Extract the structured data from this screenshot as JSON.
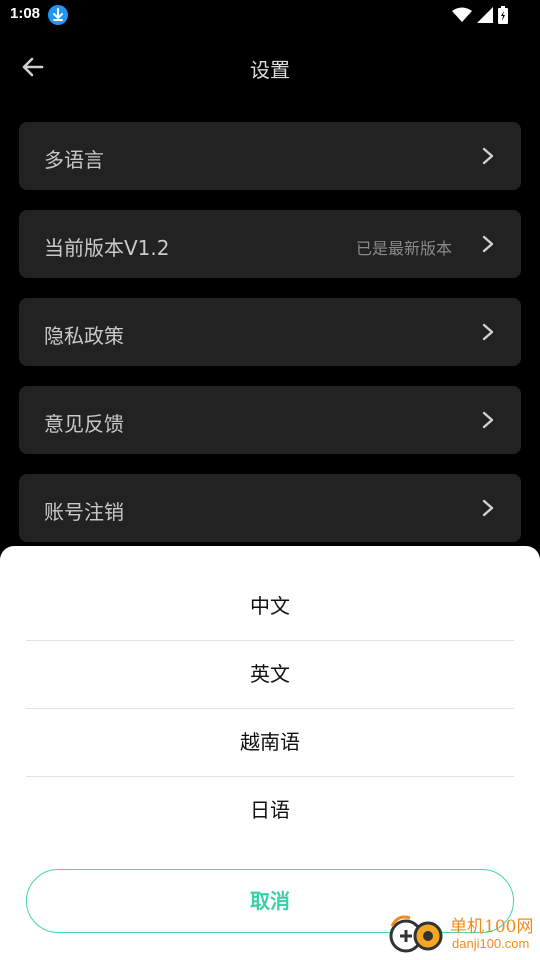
{
  "status_bar": {
    "time": "1:08"
  },
  "header": {
    "title": "设置"
  },
  "settings": [
    {
      "label": "多语言",
      "value": ""
    },
    {
      "label": "当前版本V1.2",
      "value": "已是最新版本"
    },
    {
      "label": "隐私政策",
      "value": ""
    },
    {
      "label": "意见反馈",
      "value": ""
    },
    {
      "label": "账号注销",
      "value": ""
    }
  ],
  "language_sheet": {
    "options": [
      "中文",
      "英文",
      "越南语",
      "日语"
    ],
    "cancel_label": "取消"
  },
  "watermark": {
    "name": "单机100网",
    "url": "danji100.com"
  },
  "colors": {
    "accent": "#3ccfa8",
    "card": "#222222",
    "background": "#000000",
    "watermark": "#f08a1c"
  }
}
